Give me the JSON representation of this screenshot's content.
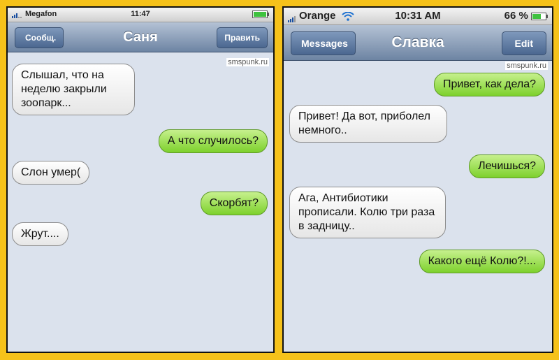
{
  "left": {
    "status": {
      "carrier": "Megafon",
      "time": "11:47"
    },
    "nav": {
      "back": "Сообщ.",
      "title": "Саня",
      "edit": "Править"
    },
    "watermark": "smspunk.ru",
    "messages": [
      {
        "dir": "in",
        "text": "Слышал, что на неделю закрыли зоопарк..."
      },
      {
        "dir": "out",
        "text": "А что случилось?"
      },
      {
        "dir": "in",
        "text": "Слон умер("
      },
      {
        "dir": "out",
        "text": "Скорбят?"
      },
      {
        "dir": "in",
        "text": "Жрут...."
      }
    ]
  },
  "right": {
    "status": {
      "carrier": "Orange",
      "time": "10:31 AM",
      "battery": "66 %"
    },
    "nav": {
      "back": "Messages",
      "title": "Славка",
      "edit": "Edit"
    },
    "watermark": "smspunk.ru",
    "messages": [
      {
        "dir": "out",
        "text": "Привет, как дела?"
      },
      {
        "dir": "in",
        "text": "Привет! Да вот, приболел немного.."
      },
      {
        "dir": "out",
        "text": "Лечишься?"
      },
      {
        "dir": "in",
        "text": "Ага, Антибиотики прописали. Колю три раза в задницу.."
      },
      {
        "dir": "out",
        "text": "Какого ещё Колю?!..."
      }
    ]
  },
  "colors": {
    "frame": "#f6c21a",
    "incoming": "#ffffff",
    "outgoing": "#9ae04f",
    "nav": "#6d84a3"
  },
  "icons": {
    "signal": "signal-bars-icon",
    "wifi": "wifi-icon",
    "battery": "battery-icon"
  }
}
